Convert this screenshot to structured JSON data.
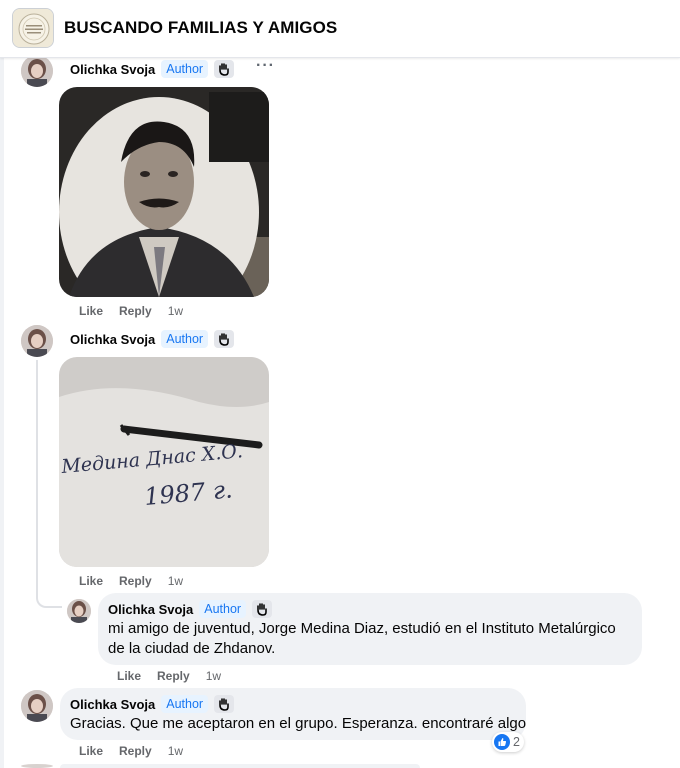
{
  "group": {
    "title": "BUSCANDO FAMILIAS Y AMIGOS"
  },
  "common": {
    "author_badge": "Author",
    "like": "Like",
    "reply": "Reply"
  },
  "comments": [
    {
      "name": "Olichka Svoja",
      "time": "1w"
    },
    {
      "name": "Olichka Svoja",
      "time": "1w",
      "photo_caption": [
        "Медина Днас Х.О.",
        "1987 г."
      ]
    },
    {
      "name": "Olichka Svoja",
      "time": "1w",
      "text": "mi amigo de juventud, Jorge Medina Diaz, estudió en el Instituto Metalúrgico de la ciudad de Zhdanov."
    },
    {
      "name": "Olichka Svoja",
      "time": "1w",
      "text": "Gracias. Que me aceptaron en el grupo. Esperanza. encontraré algo",
      "reaction_count": "2",
      "reaction_icon": "thumbs-up-icon"
    }
  ],
  "colors": {
    "author_blue": "#1877f2",
    "bubble_gray": "#f0f2f5",
    "muted_text": "#65676b"
  }
}
